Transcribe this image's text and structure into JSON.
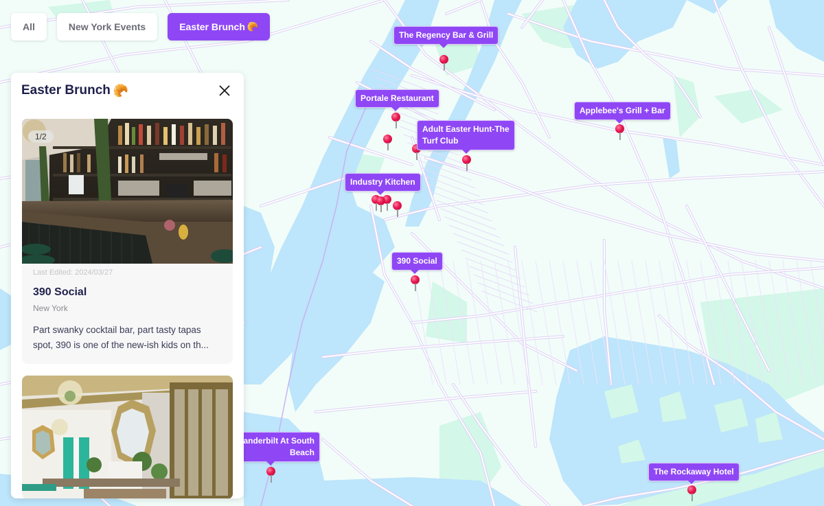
{
  "filters": [
    {
      "label": "All",
      "emoji": "",
      "active": false
    },
    {
      "label": "New York Events",
      "emoji": "",
      "active": false
    },
    {
      "label": "Easter Brunch",
      "emoji": "🥐",
      "active": true
    }
  ],
  "panel": {
    "title": "Easter Brunch",
    "title_emoji": "🥐",
    "close_icon": "close-icon",
    "cards": [
      {
        "image_counter": "1/2",
        "image_alt": "Bar interior with bottles and dark counter",
        "last_edited": "Last Edited: 2024/03/27",
        "title": "390 Social",
        "location": "New York",
        "description": "Part swanky cocktail bar, part tasty tapas spot, 390 is one of the new-ish kids on th..."
      },
      {
        "image_alt": "Ornate dining room with chandeliers and gilded mirrors"
      }
    ]
  },
  "map": {
    "colors": {
      "land": "#f2fdf9",
      "water": "#bde5fb",
      "park": "#d3f7e8",
      "road": "#ece3fb",
      "road_outline": "#ddd0f5",
      "accent": "#8f47f5",
      "pin": "#e8174f"
    },
    "markers": [
      {
        "name": "The Regency Bar & Grill",
        "labeled": true
      },
      {
        "name": "Portale Restaurant",
        "labeled": true
      },
      {
        "name": "Adult Easter Hunt-The Turf Club",
        "labeled": true
      },
      {
        "name": "Applebee's Grill + Bar",
        "labeled": true
      },
      {
        "name": "Industry Kitchen",
        "labeled": true
      },
      {
        "name": "390 Social",
        "labeled": true
      },
      {
        "name": "Vanderbilt At South Beach",
        "labeled_visible_text": "Vanderbilt At South\nh",
        "labeled": true
      },
      {
        "name": "The Rockaway Hotel",
        "labeled": true
      }
    ]
  }
}
